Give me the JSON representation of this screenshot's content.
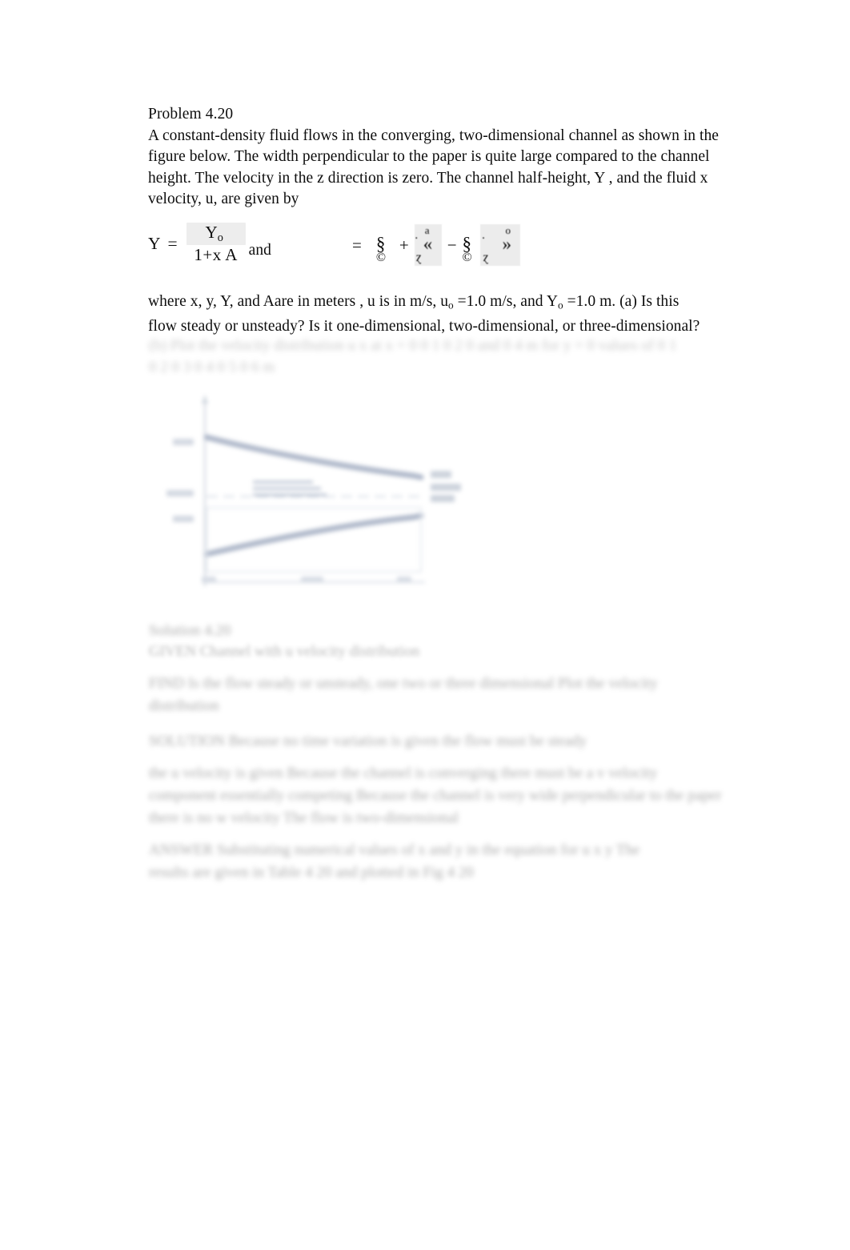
{
  "document": {
    "problem_title": "Problem 4.20",
    "problem_statement_lines": [
      "A constant-density fluid flows in the converging, two-dimensional channel as shown in the",
      "figure below. The width perpendicular to the paper is quite large compared to the channel",
      "height. The velocity in the  z direction is zero. The channel half-height,   Y , and the fluid  x",
      "velocity,  u, are given by"
    ],
    "equation": {
      "lhs_variable": "Y",
      "equals": "=",
      "numerator": "Y",
      "numerator_subscript": "o",
      "denominator": "1+x  A",
      "conjunction": "and",
      "second_equals": "=",
      "corrupt_glyphs": {
        "g1_main": "§",
        "g1_bottom": "©",
        "plus": "+",
        "g2_dot": "·",
        "g2_top": "a",
        "g2_main": "«",
        "g2_bottom": "ɀ",
        "minus": "−",
        "g3_main": "§",
        "g3_bottom": "©",
        "g4_dot": "·",
        "g4_top": "o",
        "g4_main": "»",
        "g4_bottom": "ɀ"
      }
    },
    "where_lines": [
      "where x, y, Y , and  Aare in meters , u is in m/s, u o =1.0 m/s, and Y o =1.0 m. (a) Is this",
      "flow steady or unsteady? Is it one-dimensional, two-dimensional, or three-dimensional?"
    ],
    "where_line_1_parts": {
      "a": "where x, y, ",
      "b": "Y",
      "c": ", and  ",
      "d": "A",
      "e": "are in ",
      "f": "meters",
      "g": " , ",
      "h": "u",
      "i": " is in ",
      "j": "m/s",
      "k": ", ",
      "l": "u",
      "m": "o",
      "n": " =1.0 m/s,  and ",
      "o": "Y",
      "p": "o",
      "q": " =1.0 m. (a) Is this"
    },
    "redacted_note": "obscured-text",
    "obscured_blocks": [
      {
        "name": "velocity-distribution-line",
        "lines": [
          "(b) Plot the velocity distribution   u  x  at   x = 0 0 1 0 2 0 and 0 4 m for y = 0   values of 0 1",
          "0 2  0 3  0 4  0 5  0 6  m"
        ]
      },
      {
        "name": "solution-heading",
        "lines": [
          "Solution 4.20",
          "GIVEN  Channel with   u  velocity distribution"
        ]
      },
      {
        "name": "find-block",
        "lines": [
          "FIND  Is the flow steady or unsteady, one  two  or three dimensional  Plot the velocity",
          "distribution"
        ]
      },
      {
        "name": "solution-block",
        "lines": [
          "SOLUTION  Because no time variation is given  the flow must be steady",
          "the   u velocity is given  Because the channel is converging there must be a    v velocity",
          "component essentially competing  Because the channel is very wide perpendicular to the paper",
          "there is no  w velocity  The flow is two-dimensional"
        ]
      },
      {
        "name": "answer-block",
        "lines": [
          "ANSWER  Substituting numerical values of    x  and  y  in  the equation for   u  x  y   The",
          "results are given in Table 4 20 and plotted in Fig  4 20"
        ]
      }
    ],
    "figure": {
      "name": "converging-channel-diagram",
      "description": "blurred line drawing of converging two-dimensional channel",
      "line_color": "#9aa7bd",
      "axis_color": "#b9c2cf"
    }
  }
}
